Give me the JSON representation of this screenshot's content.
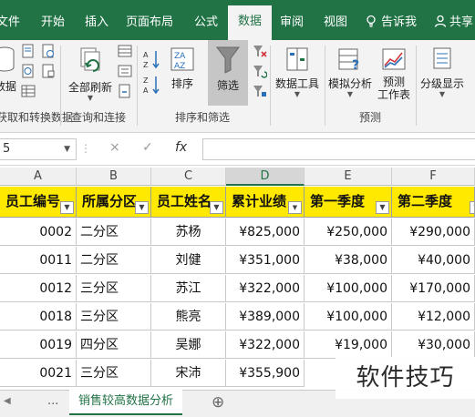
{
  "ribbon_tabs": [
    "文件",
    "开始",
    "插入",
    "页面布局",
    "公式",
    "数据",
    "审阅",
    "视图"
  ],
  "active_tab": "数据",
  "tell_me": "告诉我",
  "share": "共享",
  "ribbon": {
    "get_data_partial": "数据",
    "get_transform_group": "获取和转换数据",
    "refresh_all": "全部刷新",
    "queries_group": "查询和连接",
    "sort": "排序",
    "filter": "筛选",
    "sort_filter_group": "排序和筛选",
    "data_tools": "数据工具",
    "what_if": "模拟分析",
    "forecast_sheet_1": "预测",
    "forecast_sheet_2": "工作表",
    "forecast_group": "预测",
    "outline": "分级显示"
  },
  "formula_bar": {
    "name_box": "5",
    "cancel": "×",
    "enter": "✓",
    "fx": "fx",
    "formula": ""
  },
  "columns": [
    "A",
    "B",
    "C",
    "D",
    "E",
    "F"
  ],
  "table": {
    "headers": [
      "员工编号",
      "所属分区",
      "员工姓名",
      "累计业绩",
      "第一季度",
      "第二季度"
    ],
    "rows": [
      [
        "0002",
        "二分区",
        "苏杨",
        "¥825,000",
        "¥250,000",
        "¥290,000"
      ],
      [
        "0011",
        "二分区",
        "刘健",
        "¥351,000",
        "¥38,000",
        "¥40,000"
      ],
      [
        "0012",
        "三分区",
        "苏江",
        "¥322,000",
        "¥100,000",
        "¥170,000"
      ],
      [
        "0018",
        "三分区",
        "熊亮",
        "¥389,000",
        "¥100,000",
        "¥12,000"
      ],
      [
        "0019",
        "四分区",
        "吴娜",
        "¥322,000",
        "¥19,000",
        "¥30,000"
      ],
      [
        "0021",
        "三分区",
        "宋沛",
        "¥355,900",
        "",
        ""
      ]
    ]
  },
  "sheet": {
    "ellipsis": "...",
    "active_sheet": "销售较高数据分析",
    "add_sheet": "⊕"
  },
  "watermark": "软件技巧",
  "colors": {
    "ribbon_green": "#217346",
    "header_fill": "#ffe900"
  }
}
